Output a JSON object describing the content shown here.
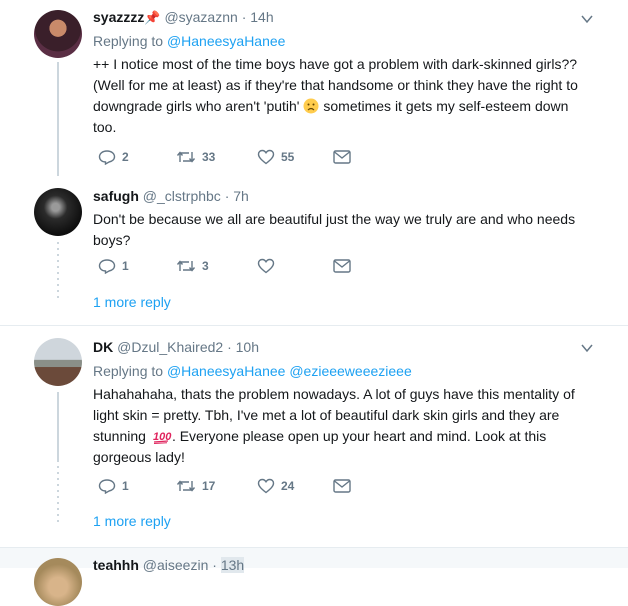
{
  "tweets": [
    {
      "name": "syazzzz",
      "pin_icon": "pushpin-icon",
      "handle": "@syazaznn",
      "time": "14h",
      "reply_label": "Replying to",
      "reply_to": "@HaneesyaHanee",
      "text_1": "++ I notice most of the time boys have got a problem with dark-skinned girls?? (Well for me at least) as if they're that handsome or think they have the right to downgrade girls who aren't 'putih'",
      "text_2": " sometimes it gets my self-esteem down too.",
      "replies": "2",
      "retweets": "33",
      "likes": "55"
    },
    {
      "name": "safugh",
      "handle": "@_clstrphbc",
      "time": "7h",
      "text": "Don't be because we all are beautiful just the way we truly are and who needs boys?",
      "replies": "1",
      "retweets": "3",
      "likes": "",
      "more_replies": "1 more reply"
    },
    {
      "name": "DK",
      "handle": "@Dzul_Khaired2",
      "time": "10h",
      "reply_label": "Replying to",
      "reply_to_1": "@HaneesyaHanee",
      "reply_to_2": "@ezieeeweeezieee",
      "text_1": "Hahahahaha, thats the problem nowadays. A lot of guys have this mentality of light skin = pretty. Tbh, I've met a lot of beautiful dark skin girls and they are stunning",
      "text_2": ". Everyone please open up your heart and mind. Look at this gorgeous lady!",
      "replies": "1",
      "retweets": "17",
      "likes": "24",
      "more_replies": "1 more reply"
    },
    {
      "name": "teahhh",
      "handle": "@aiseezin",
      "time": "13h"
    }
  ],
  "colors": {
    "accent": "#1da1f2",
    "muted": "#657786",
    "line": "#ccd6dd"
  }
}
